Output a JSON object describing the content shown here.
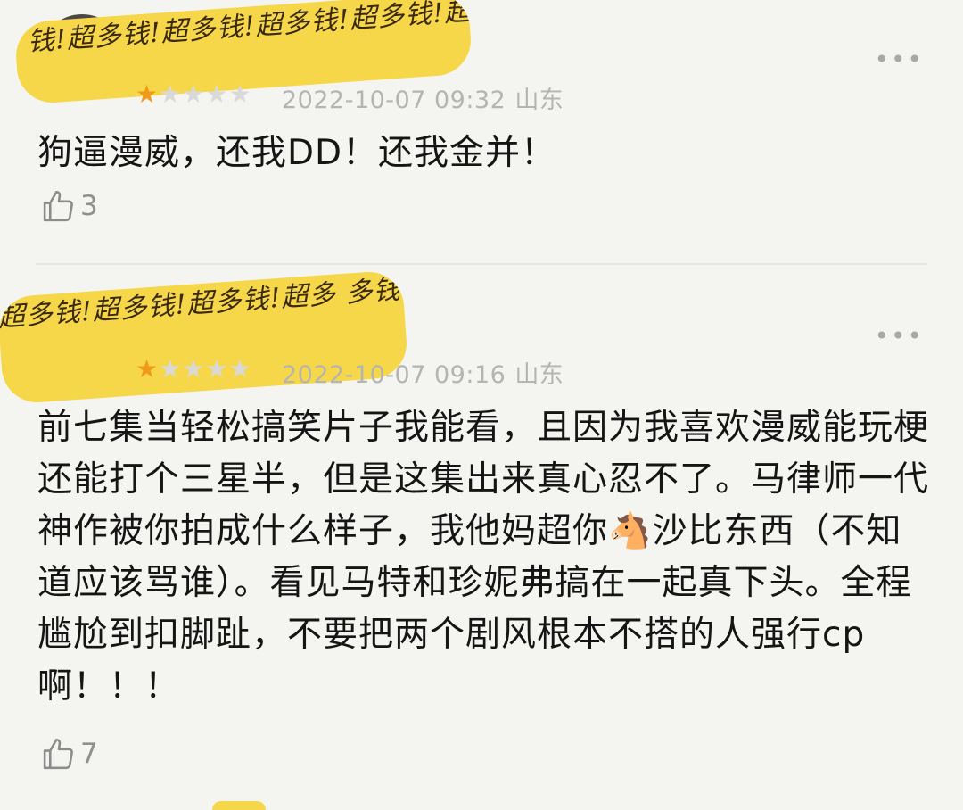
{
  "reviews": [
    {
      "rating": 1,
      "max_rating": 5,
      "date": "2022-10-07 09:32",
      "location": "山东",
      "content": "狗逼漫威，还我DD！还我金并！",
      "likes": "3",
      "sticker_text": "钱!超多钱!超多钱!超多钱!超多钱!超 切多钱!超多钱!超多钱!超多钱!超多"
    },
    {
      "rating": 1,
      "max_rating": 5,
      "date": "2022-10-07 09:16",
      "location": "山东",
      "content": "前七集当轻松搞笑片子我能看，且因为我喜欢漫威能玩梗还能打个三星半，但是这集出来真心忍不了。马律师一代神作被你拍成什么样子，我他妈超你🐴沙比东西（不知道应该骂谁）。看见马特和珍妮弗搞在一起真下头。全程尴尬到扣脚趾，不要把两个剧风根本不搭的人强行cp啊！！！",
      "likes": "7",
      "sticker_text": "超多钱!超多钱!超多钱!超多 多钱!超多钱!超多钱!超多钱! 超多钱!超多钱!超多钱!超多"
    }
  ],
  "icons": {
    "like": "thumbs-up-outline-icon",
    "more": "more-dots-icon",
    "star": "star-icon"
  },
  "colors": {
    "background": "#f4f5f0",
    "star_filled": "#f09a1a",
    "star_empty": "#d9d9d9",
    "meta_text": "#b4b4b4",
    "highlighter": "#f7d74a"
  }
}
